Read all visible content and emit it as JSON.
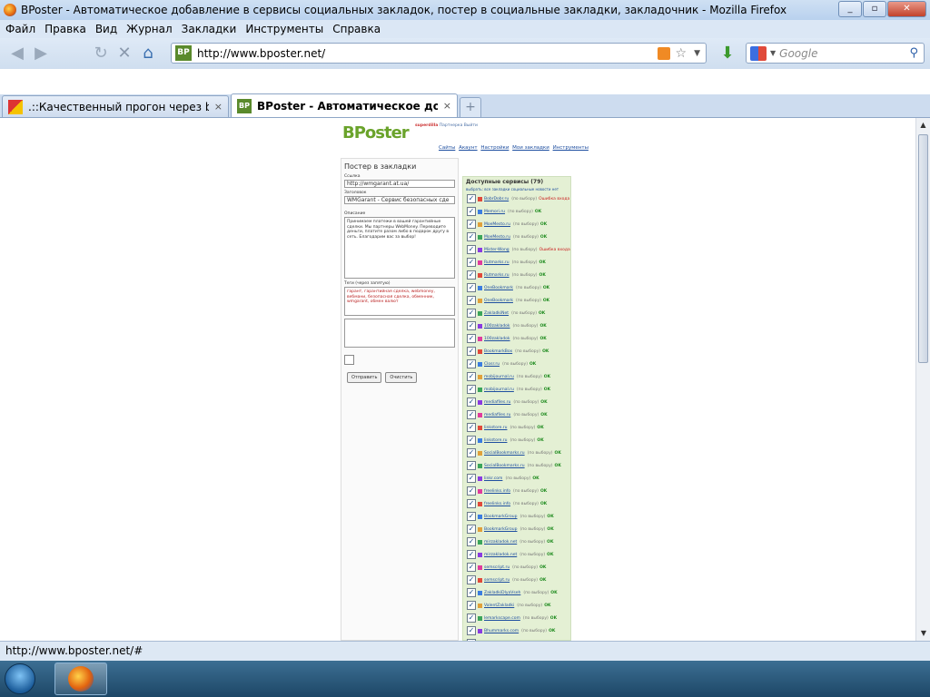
{
  "window": {
    "title": "BPoster - Автоматическое добавление в сервисы социальных закладок, постер в социальные закладки, закладочник - Mozilla Firefox"
  },
  "menu": [
    "Файл",
    "Правка",
    "Вид",
    "Журнал",
    "Закладки",
    "Инструменты",
    "Справка"
  ],
  "address": {
    "url": "http://www.bposter.net/",
    "site_icon": "BP"
  },
  "search": {
    "placeholder": "Google"
  },
  "tabs": [
    {
      "title": ".::Качественный прогон через bpo...",
      "close": "×"
    },
    {
      "title": "BPoster - Автоматическое доба...",
      "close": "×"
    }
  ],
  "newtab": "+",
  "status": "http://www.bposter.net/#",
  "page": {
    "logo_main": "BPoster",
    "logo_suffix": "",
    "user": "superdilla",
    "user_links": "Партнерка   Выйти",
    "nav": [
      "Сайты",
      "Акаунт",
      "Настройки",
      "Мои закладки",
      "Инструменты"
    ],
    "form_title": "Постер в закладки",
    "url_label": "Ссылка",
    "url_value": "http://wmgarant.at.ua/",
    "title_label": "Заголовок",
    "title_value": "WMGarant - Сервис безопасных сде",
    "desc_label": "Описание",
    "desc_value": "Принимаем платежи в вашей гарантийные сделки. Мы партнеры WebMoney. Переводите деньги, платите разом либо в подарок другу в сеть. Благодарим вас за выбор!",
    "tags_label": "Теги (через запятую)",
    "tags_value": "гарант, гарантийная сделка, webmoney, вебмани, безопасная сделка, обменник, wmgarant, обмен валют",
    "send_button": "Отправить",
    "clear_button": "Очистить",
    "services_title": "Доступные сервисы (79)",
    "services_links": "выбрать: все закладки социальные новости нет",
    "services": [
      {
        "name": "BobrDobr.ru",
        "status": "(по выбору)",
        "result": "Ошибка входа",
        "ok": false
      },
      {
        "name": "Memori.ru",
        "status": "(по выбору)",
        "result": "OK",
        "ok": true
      },
      {
        "name": "MoeMesto.ru",
        "status": "(по выбору)",
        "result": "OK",
        "ok": true
      },
      {
        "name": "MoeMesto.ru",
        "status": "(по выбору)",
        "result": "OK",
        "ok": true
      },
      {
        "name": "Mister-Wong",
        "status": "(по выбору)",
        "result": "Ошибка входа",
        "ok": false
      },
      {
        "name": "Rutmarks.ru",
        "status": "(по выбору)",
        "result": "OK",
        "ok": true
      },
      {
        "name": "Rutmarks.ru",
        "status": "(по выбору)",
        "result": "OK",
        "ok": true
      },
      {
        "name": "OneBookmark",
        "status": "(по выбору)",
        "result": "OK",
        "ok": true
      },
      {
        "name": "OneBookmark",
        "status": "(по выбору)",
        "result": "OK",
        "ok": true
      },
      {
        "name": "ZakladkiNet",
        "status": "(по выбору)",
        "result": "OK",
        "ok": true
      },
      {
        "name": "100zakladok",
        "status": "(по выбору)",
        "result": "OK",
        "ok": true
      },
      {
        "name": "100zakladok",
        "status": "(по выбору)",
        "result": "OK",
        "ok": true
      },
      {
        "name": "BookmarkBox",
        "status": "(по выбору)",
        "result": "OK",
        "ok": true
      },
      {
        "name": "Closr.ru",
        "status": "(по выбору)",
        "result": "OK",
        "ok": true
      },
      {
        "name": "mobijournal.ru",
        "status": "(по выбору)",
        "result": "OK",
        "ok": true
      },
      {
        "name": "mobijournal.ru",
        "status": "(по выбору)",
        "result": "OK",
        "ok": true
      },
      {
        "name": "mediafiles.ru",
        "status": "(по выбору)",
        "result": "OK",
        "ok": true
      },
      {
        "name": "mediafiles.ru",
        "status": "(по выбору)",
        "result": "OK",
        "ok": true
      },
      {
        "name": "linkstore.ru",
        "status": "(по выбору)",
        "result": "OK",
        "ok": true
      },
      {
        "name": "linkstore.ru",
        "status": "(по выбору)",
        "result": "OK",
        "ok": true
      },
      {
        "name": "SocialBookmarks.ru",
        "status": "(по выбору)",
        "result": "OK",
        "ok": true
      },
      {
        "name": "SocialBookmarks.ru",
        "status": "(по выбору)",
        "result": "OK",
        "ok": true
      },
      {
        "name": "linkr.com",
        "status": "(по выбору)",
        "result": "OK",
        "ok": true
      },
      {
        "name": "freelinks.info",
        "status": "(по выбору)",
        "result": "OK",
        "ok": true
      },
      {
        "name": "freelinks.info",
        "status": "(по выбору)",
        "result": "OK",
        "ok": true
      },
      {
        "name": "BookmarkGroup",
        "status": "(по выбору)",
        "result": "OK",
        "ok": true
      },
      {
        "name": "BookmarkGroup",
        "status": "(по выбору)",
        "result": "OK",
        "ok": true
      },
      {
        "name": "mirzakladok.net",
        "status": "(по выбору)",
        "result": "OK",
        "ok": true
      },
      {
        "name": "mirzakladok.net",
        "status": "(по выбору)",
        "result": "OK",
        "ok": true
      },
      {
        "name": "semscript.ru",
        "status": "(по выбору)",
        "result": "OK",
        "ok": true
      },
      {
        "name": "semscript.ru",
        "status": "(по выбору)",
        "result": "OK",
        "ok": true
      },
      {
        "name": "ZakladkiDlyaVseh",
        "status": "(по выбору)",
        "result": "OK",
        "ok": true
      },
      {
        "name": "ValentZakladki",
        "status": "(по выбору)",
        "result": "OK",
        "ok": true
      },
      {
        "name": "lemarkscape.com",
        "status": "(по выбору)",
        "result": "OK",
        "ok": true
      },
      {
        "name": "Bhummarks.com",
        "status": "(по выбору)",
        "result": "OK",
        "ok": true
      },
      {
        "name": "",
        "status": "",
        "result": "",
        "ok": true
      }
    ]
  }
}
